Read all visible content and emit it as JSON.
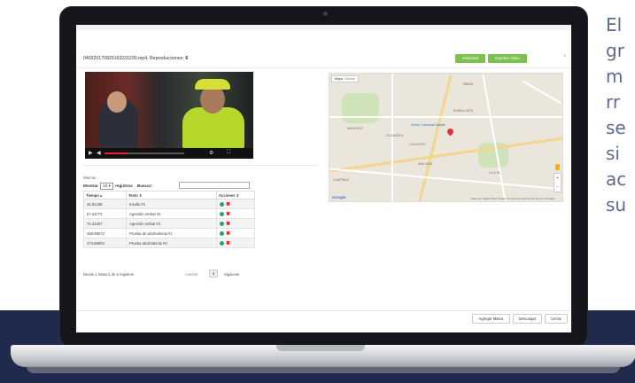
{
  "side_text": [
    "El",
    "gr",
    "m",
    "rr",
    "se",
    "si",
    "ac",
    "su"
  ],
  "video_player": {
    "file_title": "04032017092516323129​0.mp4, Reproducciones: ",
    "play_count": "6",
    "buttons": {
      "speed_label": "Velocidad",
      "export_label": "Exportar Video"
    }
  },
  "marks_panel": {
    "section_label": "Marcas",
    "show_label": "Mostrar",
    "entries_value": "10",
    "records_label": "registros",
    "search_label": "Buscar:",
    "search_value": "",
    "columns": [
      "Tiempo",
      "Texto",
      "Acciones"
    ],
    "rows": [
      {
        "time": "26.81438",
        "text": "Insulto #1"
      },
      {
        "time": "67.24773",
        "text": "Agresión Verbal #2"
      },
      {
        "time": "75.31057",
        "text": "Agresión verbal #3"
      },
      {
        "time": "459.99572",
        "text": "Prueba de alcoholemia #1"
      },
      {
        "time": "474.88903",
        "text": "Prueba alcoholemia #2"
      }
    ],
    "info": "Desde 1 hasta 5 de 5 registros",
    "prev_label": "Anterior",
    "page": "1",
    "next_label": "Siguiente"
  },
  "map": {
    "type_buttons": [
      "Mapa",
      "Satélite"
    ],
    "labels": [
      "TABATA",
      "BUENA VISTA",
      "LOS ALPES",
      "MUNICIPIO",
      "CAMPINAS",
      "LA CITA",
      "CIUDADELA",
      "SAN JOSE"
    ],
    "place_pin": "Centro Comercial Santafe",
    "footer": "Datos de mapas ©2017 Google  Términos de uso  Informar un error de Maps",
    "google": "Google"
  },
  "footer_buttons": {
    "add_mark": "Agregar Marca",
    "download": "Descargar",
    "close": "Cerrar"
  },
  "colors": {
    "accent_green": "#7cc24d",
    "navy_band": "#1f2a4d",
    "delete_red": "#ee1111"
  },
  "video_progress": 0.28
}
